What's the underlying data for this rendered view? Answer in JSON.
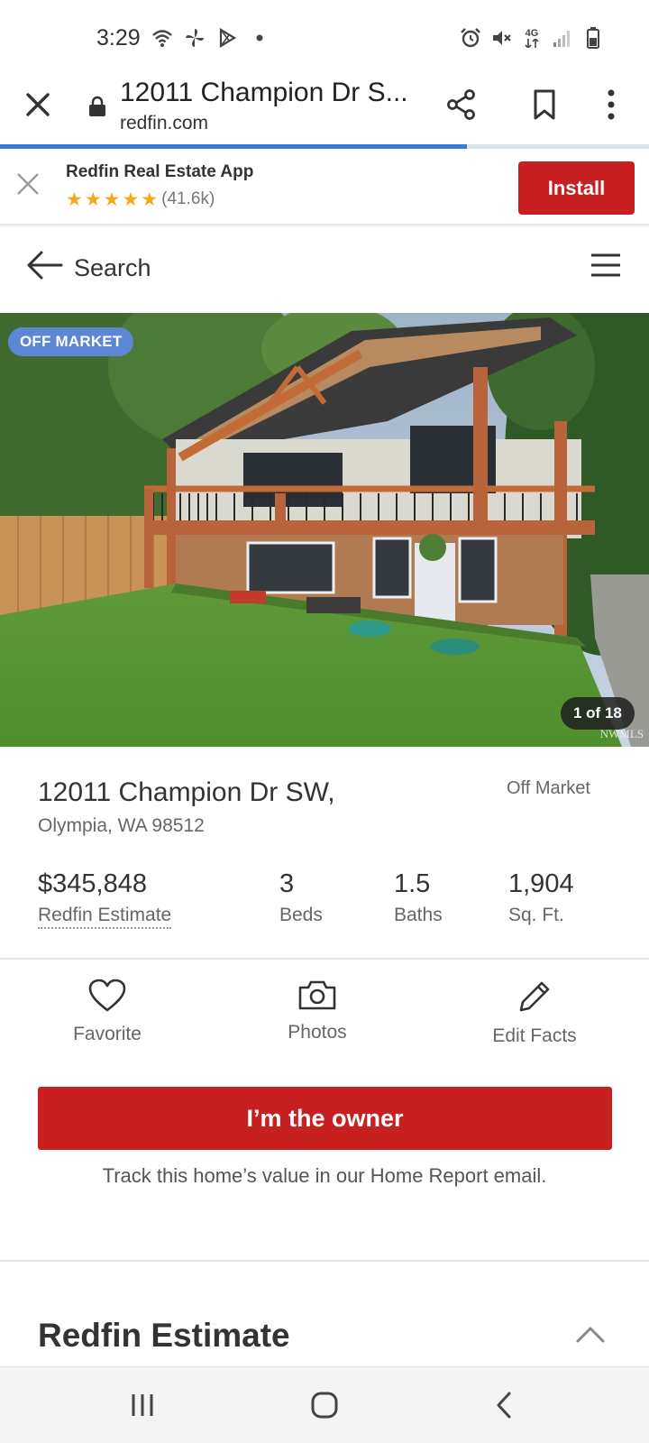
{
  "status_bar": {
    "time": "3:29",
    "left_icons": [
      "wifi-icon",
      "pinwheel-icon",
      "play-store-icon",
      "dot-icon"
    ],
    "right_icons": [
      "alarm-icon",
      "mute-icon",
      "4g-data-icon",
      "signal-icon",
      "battery-icon"
    ],
    "network_label": "4G"
  },
  "browser": {
    "page_title": "12011 Champion Dr S...",
    "domain": "redfin.com",
    "load_progress": 0.72
  },
  "app_banner": {
    "title": "Redfin Real Estate App",
    "rating_stars": 5,
    "rating_count": "(41.6k)",
    "install_label": "Install"
  },
  "search_header": {
    "label": "Search"
  },
  "photo": {
    "status_badge": "OFF MARKET",
    "counter": "1 of 18",
    "watermark": "NWMLS"
  },
  "property": {
    "address_line1": "12011 Champion Dr SW,",
    "address_line2": "Olympia, WA 98512",
    "status": "Off Market",
    "estimate_value": "$345,848",
    "estimate_label": "Redfin Estimate",
    "beds_value": "3",
    "beds_label": "Beds",
    "baths_value": "1.5",
    "baths_label": "Baths",
    "sqft_value": "1,904",
    "sqft_label": "Sq. Ft."
  },
  "actions": {
    "favorite": "Favorite",
    "photos": "Photos",
    "edit_facts": "Edit Facts"
  },
  "owner": {
    "button_label": "I’m the owner",
    "note": "Track this home’s value in our Home Report email."
  },
  "section": {
    "title": "Redfin Estimate"
  },
  "colors": {
    "brand_red": "#c82021",
    "badge_blue": "#5c86d6",
    "star_gold": "#f2a91f",
    "progress_blue": "#3b78d8"
  }
}
